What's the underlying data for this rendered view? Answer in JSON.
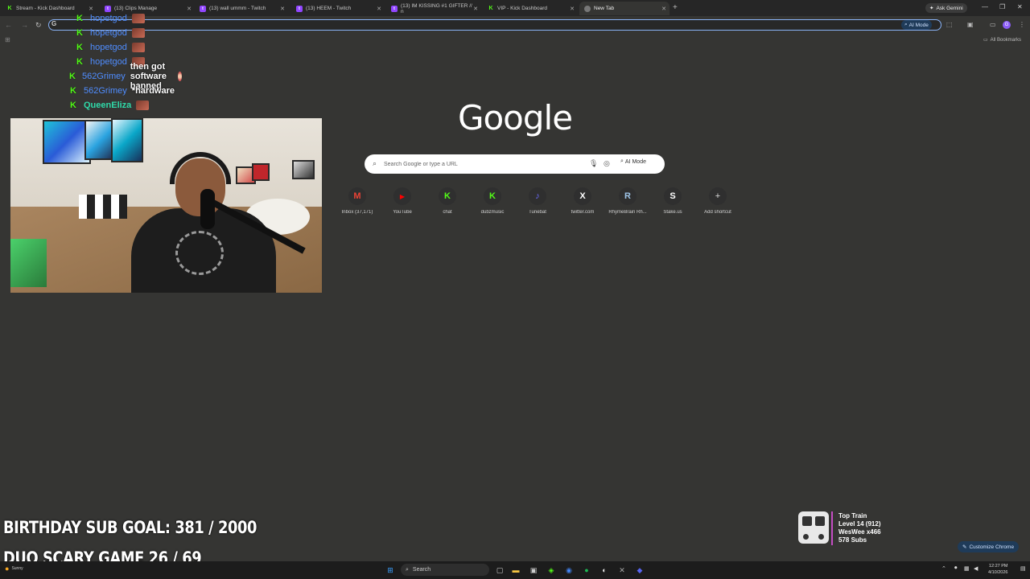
{
  "tabs": [
    {
      "title": "Stream - Kick Dashboard",
      "icon": "kick-icon"
    },
    {
      "title": "(13) Clips Manage",
      "icon": "twitch-icon"
    },
    {
      "title": "(13) wall ummm - Twitch",
      "icon": "twitch-icon"
    },
    {
      "title": "(13) HEEM - Twitch",
      "icon": "twitch-icon"
    },
    {
      "title": "(13) IM KISSING #1 GIFTER // n",
      "icon": "twitch-icon"
    },
    {
      "title": "VIP - Kick Dashboard",
      "icon": "kick-icon"
    },
    {
      "title": "New Tab",
      "icon": "chrome-icon"
    }
  ],
  "browser": {
    "ask_gemini": "Ask Gemini",
    "ai_mode": "AI Mode",
    "all_bookmarks": "All Bookmarks"
  },
  "chat": [
    {
      "user": "hopetgod",
      "message": "",
      "color": "#4f8dff"
    },
    {
      "user": "hopetgod",
      "message": "",
      "color": "#4f8dff"
    },
    {
      "user": "hopetgod",
      "message": "",
      "color": "#4f8dff"
    },
    {
      "user": "562Grimey",
      "message": "then got software banned",
      "color": "#4f8dff"
    },
    {
      "user": "562Grimey",
      "message": "*hardware",
      "color": "#4f8dff"
    },
    {
      "user": "QueenEliza",
      "message": "",
      "color": "#2fd9a8"
    }
  ],
  "ntp": {
    "logo": "Google",
    "search_placeholder": "Search Google or type a URL",
    "ai_mode": "AI Mode",
    "shortcuts": [
      {
        "label": "Inbox (37,171)",
        "glyph": "M",
        "color": "#ea4335"
      },
      {
        "label": "YouTube",
        "glyph": "▶",
        "color": "#ff0000"
      },
      {
        "label": "chat",
        "glyph": "K",
        "color": "#53fc18"
      },
      {
        "label": "dubzmusic",
        "glyph": "K",
        "color": "#53fc18"
      },
      {
        "label": "Tunebat",
        "glyph": "♪",
        "color": "#6b6bff"
      },
      {
        "label": "twitter.com",
        "glyph": "X",
        "color": "#ffffff"
      },
      {
        "label": "RhymeBrain Rh...",
        "glyph": "R",
        "color": "#9fc5e8"
      },
      {
        "label": "Stake.us",
        "glyph": "S",
        "color": "#ffffff"
      },
      {
        "label": "Add shortcut",
        "glyph": "+",
        "color": "#dddddd"
      }
    ],
    "customize": "Customize Chrome"
  },
  "overlay": {
    "goal1": "BIRTHDAY SUB GOAL:  381 / 2000",
    "goal2": "DUO SCARY GAME  26 / 69",
    "train_title": "Top Train",
    "train_level": "Level 14  (912)",
    "train_top": "WesWee x466",
    "train_subs": "578 Subs",
    "accent_color": "#c44dc4"
  },
  "taskbar": {
    "search": "Search",
    "weather": "Sunny",
    "time": "12:27 PM",
    "date": "4/10/2026"
  }
}
